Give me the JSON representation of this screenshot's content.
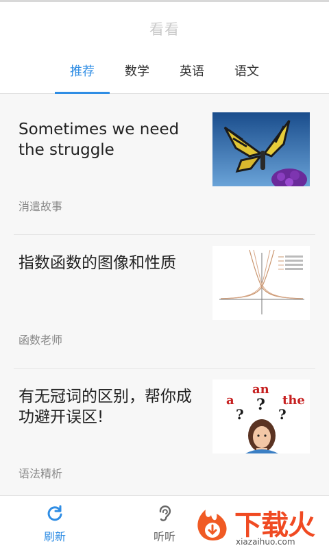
{
  "header": {
    "title": "看看",
    "tabs": [
      {
        "label": "推荐",
        "active": true
      },
      {
        "label": "数学",
        "active": false
      },
      {
        "label": "英语",
        "active": false
      },
      {
        "label": "语文",
        "active": false
      }
    ]
  },
  "feed": {
    "cards": [
      {
        "title": "Sometimes we need the struggle",
        "source": "消遣故事",
        "thumb": "butterfly-photo"
      },
      {
        "title": "指数函数的图像和性质",
        "source": "函数老师",
        "thumb": "exponential-function-graph"
      },
      {
        "title": "有无冠词的区别，帮你成功避开误区!",
        "source": "语法精析",
        "thumb": "article-question-illustration",
        "thumb_text": {
          "a": "a",
          "an": "an",
          "the": "the",
          "q": "?"
        }
      }
    ]
  },
  "bottom_nav": {
    "items": [
      {
        "label": "刷新",
        "icon": "refresh-icon",
        "active": true
      },
      {
        "label": "听听",
        "icon": "ear-icon",
        "active": false
      }
    ]
  },
  "watermark": {
    "text": "下载火",
    "url": "xiazaihuo.com"
  },
  "colors": {
    "accent": "#2f8de4",
    "watermark": "#f04a22"
  }
}
